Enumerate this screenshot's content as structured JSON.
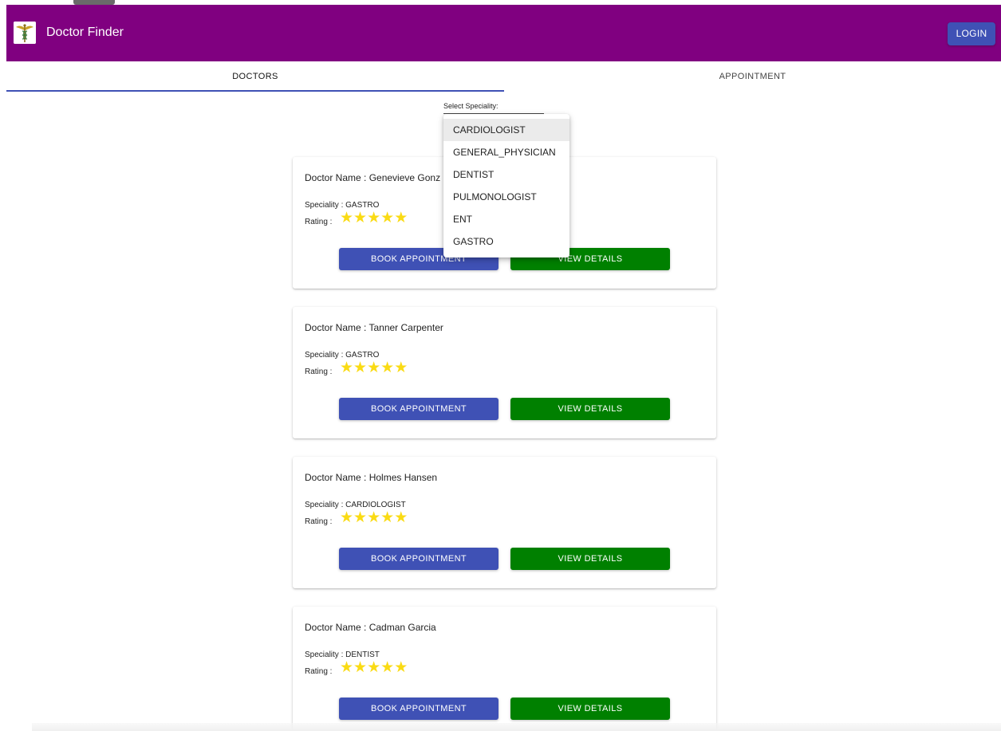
{
  "app": {
    "title": "Doctor Finder",
    "login_label": "LOGIN",
    "colors": {
      "appbar": "#800080",
      "primary": "#3f51b5",
      "success": "#008000",
      "star": "#fadb14"
    },
    "logo_icon": "caduceus-icon"
  },
  "tabs": [
    {
      "label": "DOCTORS",
      "active": true
    },
    {
      "label": "APPOINTMENT",
      "active": false
    }
  ],
  "filter": {
    "label": "Select Speciality:",
    "options": [
      "CARDIOLOGIST",
      "GENERAL_PHYSICIAN",
      "DENTIST",
      "PULMONOLOGIST",
      "ENT",
      "GASTRO"
    ],
    "highlighted": "CARDIOLOGIST"
  },
  "doctors": [
    {
      "name_text": "Doctor Name : Genevieve Gonz",
      "speciality_text": "Speciality : GASTRO",
      "rating_label": "Rating :",
      "rating": 5,
      "book_label": "BOOK APPOINTMENT",
      "view_label": "VIEW DETAILS"
    },
    {
      "name_text": "Doctor Name : Tanner Carpenter",
      "speciality_text": "Speciality : GASTRO",
      "rating_label": "Rating :",
      "rating": 5,
      "book_label": "BOOK APPOINTMENT",
      "view_label": "VIEW DETAILS"
    },
    {
      "name_text": "Doctor Name : Holmes Hansen",
      "speciality_text": "Speciality : CARDIOLOGIST",
      "rating_label": "Rating :",
      "rating": 5,
      "book_label": "BOOK APPOINTMENT",
      "view_label": "VIEW DETAILS"
    },
    {
      "name_text": "Doctor Name : Cadman Garcia",
      "speciality_text": "Speciality : DENTIST",
      "rating_label": "Rating :",
      "rating": 5,
      "book_label": "BOOK APPOINTMENT",
      "view_label": "VIEW DETAILS"
    }
  ]
}
